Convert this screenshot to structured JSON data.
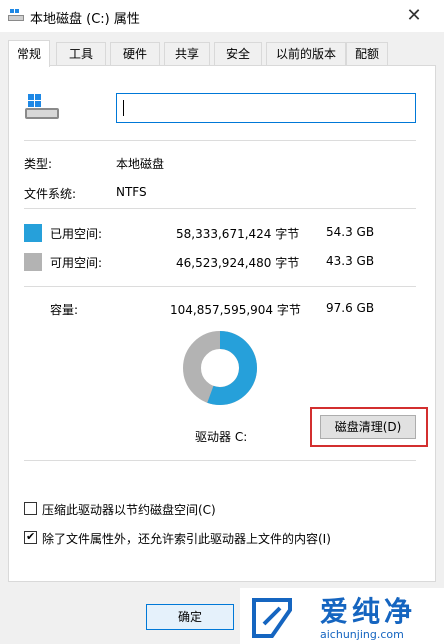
{
  "window": {
    "title": "本地磁盘 (C:) 属性",
    "close_glyph": "✕"
  },
  "tabs": [
    {
      "label": "常规",
      "active": true
    },
    {
      "label": "工具"
    },
    {
      "label": "硬件"
    },
    {
      "label": "共享"
    },
    {
      "label": "安全"
    },
    {
      "label": "以前的版本"
    },
    {
      "label": "配额"
    }
  ],
  "general": {
    "name_input_value": "",
    "type_label": "类型:",
    "type_value": "本地磁盘",
    "fs_label": "文件系统:",
    "fs_value": "NTFS",
    "used": {
      "label": "已用空间:",
      "bytes": "58,333,671,424 字节",
      "size": "54.3 GB",
      "color": "#26a0da"
    },
    "free": {
      "label": "可用空间:",
      "bytes": "46,523,924,480 字节",
      "size": "43.3 GB",
      "color": "#b3b3b3"
    },
    "capacity": {
      "label": "容量:",
      "bytes": "104,857,595,904 字节",
      "size": "97.6 GB"
    },
    "drive_label": "驱动器 C:",
    "cleanup_button": "磁盘清理(D)",
    "used_fraction": 0.556
  },
  "options": [
    {
      "label": "压缩此驱动器以节约磁盘空间(C)",
      "checked": false
    },
    {
      "label": "除了文件属性外，还允许索引此驱动器上文件的内容(I)",
      "checked": true
    }
  ],
  "footer": {
    "ok_button": "确定"
  },
  "watermark": {
    "text_cn": "爱纯净",
    "url": "aichunjing.com",
    "color": "#1565c0"
  }
}
